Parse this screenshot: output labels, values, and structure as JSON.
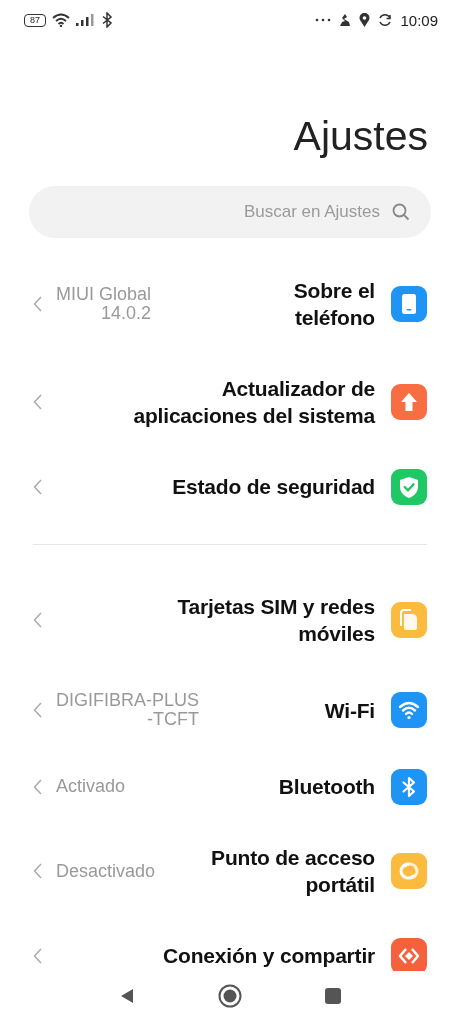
{
  "status_bar": {
    "battery": "87",
    "time": "10:09"
  },
  "title": "Ajustes",
  "search": {
    "placeholder": "Buscar en Ajustes"
  },
  "groups": [
    {
      "items": [
        {
          "title": "Sobre el\nteléfono",
          "value": "MIUI Global\n14.0.2",
          "color": "#1e95f5"
        },
        {
          "title": "Actualizador de\naplicaciones del sistema",
          "color": "#f86e42"
        },
        {
          "title": "Estado de seguridad",
          "color": "#1dc865"
        }
      ]
    },
    {
      "items": [
        {
          "title": "Tarjetas SIM y redes\nmóviles",
          "color": "#fbbb3e"
        },
        {
          "title": "Wi-Fi",
          "value": "DIGIFIBRA-PLUS\n-TCFT",
          "color": "#1e95f5"
        },
        {
          "title": "Bluetooth",
          "value": "Activado",
          "color": "#1e95f5"
        },
        {
          "title": "Punto de acceso\nportátil",
          "value": "Desactivado",
          "color": "#fbbb3e"
        },
        {
          "title": "Conexión y compartir",
          "color": "#f5603d"
        }
      ]
    }
  ]
}
